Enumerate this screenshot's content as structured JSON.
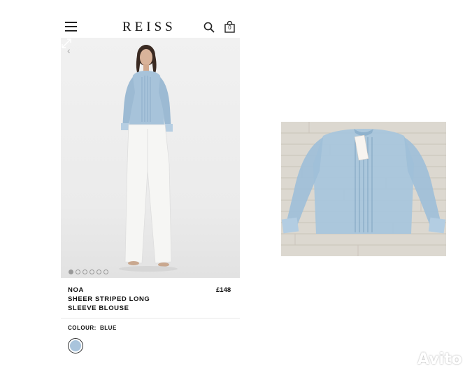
{
  "header": {
    "brand": "REISS",
    "bag_count": "0",
    "icons": [
      "menu-icon",
      "search-icon",
      "shopping-bag-icon"
    ]
  },
  "gallery": {
    "dot_count": 6,
    "active_dot": 0,
    "icons": [
      "chevron-left-icon",
      "expand-icon"
    ]
  },
  "product": {
    "name_line1": "NOA",
    "name_line2": "SHEER STRIPED LONG",
    "name_line3": "SLEEVE BLOUSE",
    "price": "£148",
    "colour_label": "COLOUR:",
    "colour_value": "BLUE",
    "swatch_color": "#a9c4dc"
  },
  "watermark": {
    "text": "Avito"
  },
  "colors": {
    "blouse": "#a7c3da",
    "trousers": "#f4f4f2",
    "wood_background": "#d9d4cc"
  }
}
